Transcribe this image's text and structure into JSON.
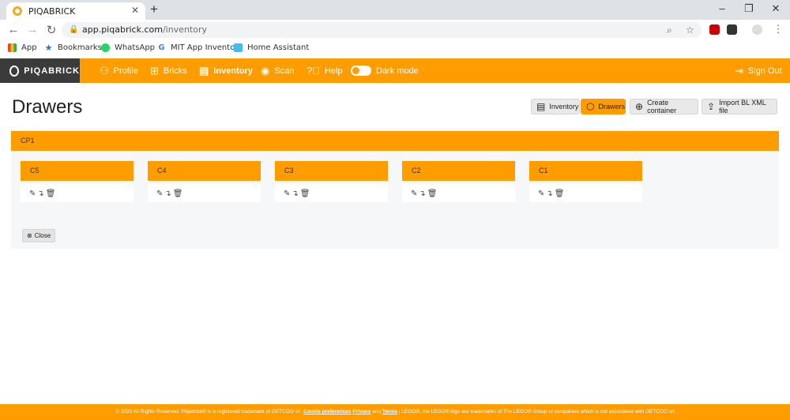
{
  "browser": {
    "tab_title": "PIQABRICK",
    "url_host": "app.piqabrick.com",
    "url_path": "/inventory"
  },
  "bookmarks": [
    {
      "label": "App",
      "icon": "apps-grid-icon"
    },
    {
      "label": "Bookmarks",
      "icon": "star-icon"
    },
    {
      "label": "WhatsApp",
      "icon": "whatsapp-icon"
    },
    {
      "label": "MIT App Inventor",
      "icon": "google-icon"
    },
    {
      "label": "Home Assistant",
      "icon": "home-assistant-icon"
    }
  ],
  "app": {
    "logo": "PIQABRICK",
    "menu": [
      {
        "label": "Profile",
        "icon": "user-icon"
      },
      {
        "label": "Bricks",
        "icon": "grid-icon"
      },
      {
        "label": "Inventory",
        "icon": "archive-box-icon"
      },
      {
        "label": "Scan",
        "icon": "eye-icon"
      },
      {
        "label": "Help",
        "icon": "help-circle-icon"
      },
      {
        "label": "Dark mode",
        "icon": "toggle-icon"
      }
    ],
    "sign_out": "Sign Out",
    "accent_color": "#ff9c00"
  },
  "page": {
    "title": "Drawers",
    "toolbar": {
      "inventory": "Inventory",
      "drawers": "Drawers",
      "create": "Create container",
      "import": "Import BL XML file"
    },
    "container": {
      "name": "CP1",
      "drawers": [
        "C5",
        "C4",
        "C3",
        "C2",
        "C1"
      ],
      "close": "Close"
    }
  },
  "footer": {
    "prefix": "© 2020 All Rights Reserved. Piqabrick® is a registered trademark of GETCOO srl.",
    "cookie": "Cookie preferences",
    "privacy": "Privacy",
    "and": "and",
    "terms": "Terms",
    "suffix": "| LEGO®, the LEGO® logo are trademarks of The LEGO® Group of companies which is not associated with GETCOO srl"
  }
}
